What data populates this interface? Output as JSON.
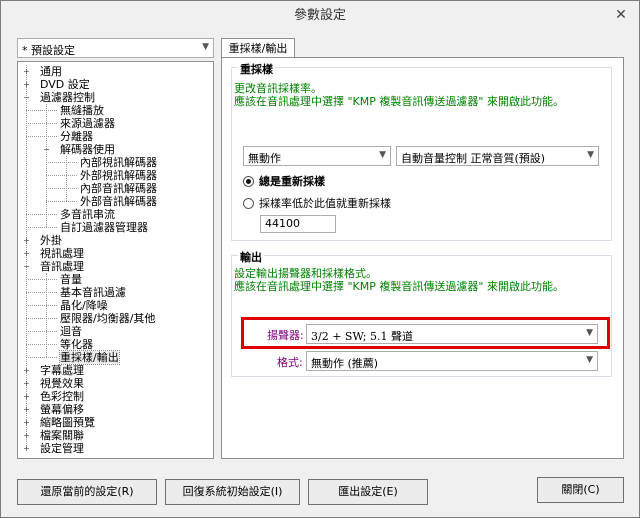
{
  "window": {
    "title": "參數設定",
    "close_glyph": "✕"
  },
  "preset": {
    "value": "* 預設設定",
    "arrow": "▼"
  },
  "tree": {
    "items": [
      {
        "label": "通用",
        "exp": "+"
      },
      {
        "label": "DVD 設定",
        "exp": "+"
      },
      {
        "label": "過濾器控制",
        "exp": "−"
      },
      {
        "label": "無縫播放"
      },
      {
        "label": "來源過濾器"
      },
      {
        "label": "分離器"
      },
      {
        "label": "解碼器使用",
        "exp": "−"
      },
      {
        "label": "內部視訊解碼器"
      },
      {
        "label": "外部視訊解碼器"
      },
      {
        "label": "內部音訊解碼器"
      },
      {
        "label": "外部音訊解碼器"
      },
      {
        "label": "多音訊串流"
      },
      {
        "label": "自訂過濾器管理器"
      },
      {
        "label": "外掛",
        "exp": "+"
      },
      {
        "label": "視訊處理",
        "exp": "+"
      },
      {
        "label": "音訊處理",
        "exp": "−"
      },
      {
        "label": "音量"
      },
      {
        "label": "基本音訊過濾"
      },
      {
        "label": "晶化/降噪"
      },
      {
        "label": "壓限器/均衡器/其他"
      },
      {
        "label": "迴音"
      },
      {
        "label": "等化器"
      },
      {
        "label": "重採樣/輸出"
      },
      {
        "label": "字幕處理",
        "exp": "+"
      },
      {
        "label": "視覺效果",
        "exp": "+"
      },
      {
        "label": "色彩控制",
        "exp": "+"
      },
      {
        "label": "螢幕偏移",
        "exp": "+"
      },
      {
        "label": "縮略圖預覽",
        "exp": "+"
      },
      {
        "label": "檔案關聯",
        "exp": "+"
      },
      {
        "label": "設定管理",
        "exp": "+"
      }
    ]
  },
  "tab": {
    "label": "重採樣/輸出"
  },
  "resample": {
    "title": "重採樣",
    "desc_line1": "更改音訊採樣率。",
    "desc_line2": "應該在音訊處理中選擇 \"KMP 複製音訊傳送過濾器\" 來開啟此功能。",
    "combo1": "無動作",
    "combo2": "自動音量控制 正常音質(預設)",
    "radio1": "總是重新採樣",
    "radio2": "採樣率低於此值就重新採樣",
    "rate": "44100"
  },
  "output": {
    "title": "輸出",
    "desc_line1": "設定輸出揚聲器和採樣格式。",
    "desc_line2": "應該在音訊處理中選擇 \"KMP 複製音訊傳送過濾器\" 來開啟此功能。",
    "speaker_label": "揚聲器:",
    "speaker_value": "3/2 + SW; 5.1 聲道",
    "format_label": "格式:",
    "format_value": "無動作 (推薦)"
  },
  "buttons": {
    "restore_prev": "還原當前的設定(R)",
    "restore_default": "回復系統初始設定(I)",
    "export": "匯出設定(E)",
    "close": "關閉(C)"
  },
  "colors": {
    "accent_highlight": "#e00000",
    "desc_green": "#008000",
    "label_purple": "#800080"
  }
}
